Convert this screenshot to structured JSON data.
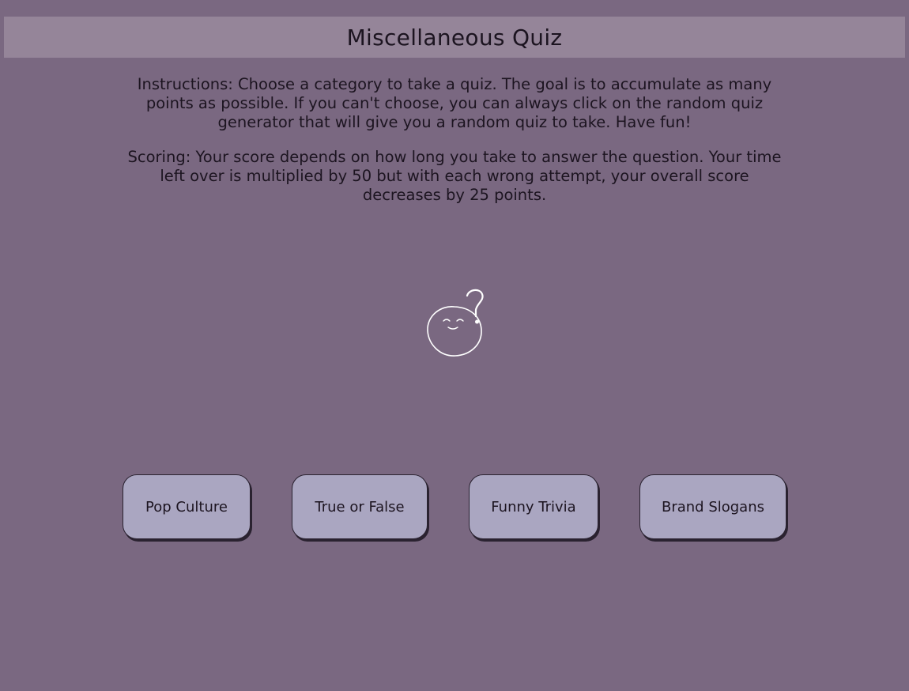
{
  "header": {
    "title": "Miscellaneous Quiz"
  },
  "content": {
    "instructions": "Instructions: Choose a category to take a quiz. The goal is to accumulate as many points as possible. If you can't choose, you can always click on the random quiz generator that will give you a random quiz to take. Have fun!",
    "scoring": "Scoring: Your score depends on how long you take to answer the question. Your time left over is multiplied by 50 but with each wrong attempt, your overall score decreases by 25 points."
  },
  "mascot": {
    "icon": "question-face-icon"
  },
  "categories": [
    {
      "label": "Pop Culture"
    },
    {
      "label": "True or False"
    },
    {
      "label": "Funny Trivia"
    },
    {
      "label": "Brand Slogans"
    }
  ],
  "colors": {
    "background": "#7a6881",
    "header_bar": "#958599",
    "button_fill": "#aaa6c1",
    "text": "#1c1420"
  }
}
